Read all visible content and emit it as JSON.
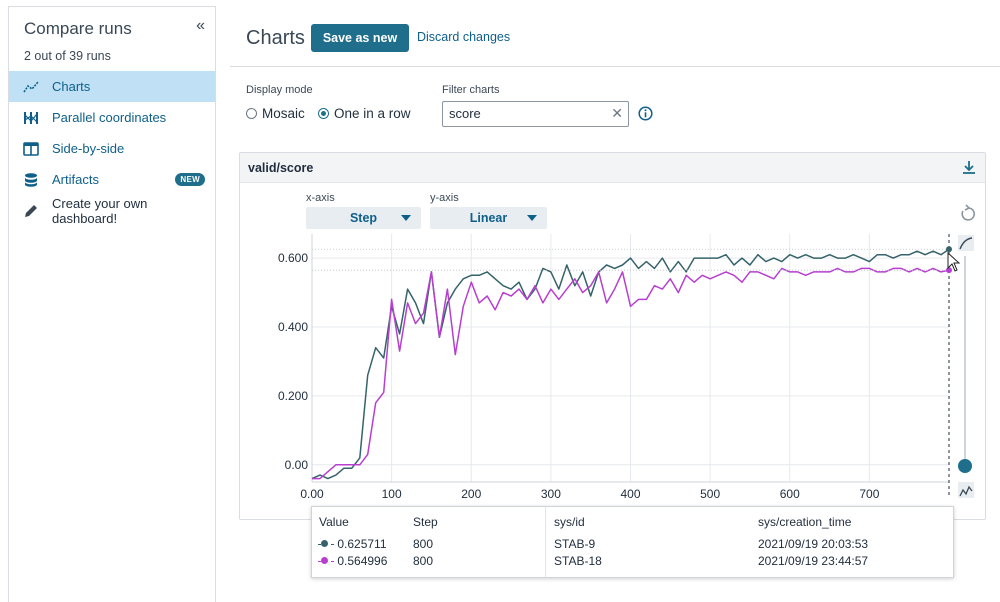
{
  "sidebar": {
    "title": "Compare runs",
    "collapse_glyph": "«",
    "subtitle": "2 out of 39 runs",
    "items": [
      {
        "label": "Charts",
        "icon": "line-chart-icon",
        "active": true
      },
      {
        "label": "Parallel coordinates",
        "icon": "parallel-coordinates-icon"
      },
      {
        "label": "Side-by-side",
        "icon": "side-by-side-icon"
      },
      {
        "label": "Artifacts",
        "icon": "database-icon",
        "badge": "NEW"
      },
      {
        "label": "Create your own dashboard!",
        "icon": "pencil-icon"
      }
    ]
  },
  "header": {
    "title": "Charts",
    "save_label": "Save as new",
    "discard_label": "Discard changes"
  },
  "controls": {
    "display_mode_label": "Display mode",
    "mode_options": [
      "Mosaic",
      "One in a row"
    ],
    "selected_mode": "One in a row",
    "filter_label": "Filter charts",
    "filter_value": "score",
    "clear_glyph": "✕"
  },
  "panel": {
    "title": "valid/score",
    "x_axis_label": "x-axis",
    "x_axis_value": "Step",
    "y_axis_label": "y-axis",
    "y_axis_value": "Linear"
  },
  "colors": {
    "accent": "#1f6e8c",
    "series_1": "#35636b",
    "series_2": "#b73fd0"
  },
  "chart_data": {
    "type": "line",
    "xlabel": "",
    "ylabel": "",
    "xlim": [
      0,
      800
    ],
    "ylim": [
      -0.05,
      0.67
    ],
    "x_ticks": [
      "0.00",
      "100",
      "200",
      "300",
      "400",
      "500",
      "600",
      "700"
    ],
    "y_ticks": [
      "0.00",
      "0.200",
      "0.400",
      "0.600"
    ],
    "cursor_x": 800,
    "series": [
      {
        "name": "STAB-9",
        "color": "#35636b",
        "x": [
          0,
          10,
          20,
          30,
          40,
          50,
          60,
          70,
          80,
          90,
          100,
          110,
          120,
          130,
          140,
          150,
          160,
          170,
          180,
          190,
          200,
          210,
          220,
          230,
          240,
          250,
          260,
          270,
          280,
          290,
          300,
          310,
          320,
          330,
          340,
          350,
          360,
          370,
          380,
          390,
          400,
          410,
          420,
          430,
          440,
          450,
          460,
          470,
          480,
          490,
          500,
          510,
          520,
          530,
          540,
          550,
          560,
          570,
          580,
          590,
          600,
          610,
          620,
          630,
          640,
          650,
          660,
          670,
          680,
          690,
          700,
          710,
          720,
          730,
          740,
          750,
          760,
          770,
          780,
          790,
          800
        ],
        "values": [
          -0.04,
          -0.03,
          -0.04,
          -0.03,
          -0.01,
          -0.01,
          0.02,
          0.26,
          0.34,
          0.31,
          0.46,
          0.38,
          0.51,
          0.47,
          0.41,
          0.56,
          0.37,
          0.47,
          0.51,
          0.54,
          0.55,
          0.55,
          0.56,
          0.54,
          0.52,
          0.51,
          0.53,
          0.48,
          0.51,
          0.57,
          0.56,
          0.51,
          0.58,
          0.52,
          0.56,
          0.49,
          0.56,
          0.58,
          0.57,
          0.58,
          0.6,
          0.57,
          0.59,
          0.57,
          0.6,
          0.56,
          0.59,
          0.56,
          0.6,
          0.6,
          0.6,
          0.6,
          0.61,
          0.58,
          0.6,
          0.58,
          0.61,
          0.59,
          0.6,
          0.59,
          0.61,
          0.6,
          0.61,
          0.6,
          0.6,
          0.61,
          0.6,
          0.6,
          0.61,
          0.6,
          0.59,
          0.61,
          0.61,
          0.6,
          0.61,
          0.61,
          0.62,
          0.61,
          0.62,
          0.61,
          0.625711
        ]
      },
      {
        "name": "STAB-18",
        "color": "#b73fd0",
        "x": [
          0,
          10,
          20,
          30,
          40,
          50,
          60,
          70,
          80,
          90,
          100,
          110,
          120,
          130,
          140,
          150,
          160,
          170,
          180,
          190,
          200,
          210,
          220,
          230,
          240,
          250,
          260,
          270,
          280,
          290,
          300,
          310,
          320,
          330,
          340,
          350,
          360,
          370,
          380,
          390,
          400,
          410,
          420,
          430,
          440,
          450,
          460,
          470,
          480,
          490,
          500,
          510,
          520,
          530,
          540,
          550,
          560,
          570,
          580,
          590,
          600,
          610,
          620,
          630,
          640,
          650,
          660,
          670,
          680,
          690,
          700,
          710,
          720,
          730,
          740,
          750,
          760,
          770,
          780,
          790,
          800
        ],
        "values": [
          -0.04,
          -0.04,
          -0.02,
          0.0,
          0.0,
          0.0,
          0.0,
          0.03,
          0.18,
          0.21,
          0.48,
          0.33,
          0.47,
          0.41,
          0.44,
          0.56,
          0.37,
          0.51,
          0.32,
          0.46,
          0.53,
          0.47,
          0.49,
          0.45,
          0.5,
          0.49,
          0.51,
          0.48,
          0.52,
          0.47,
          0.51,
          0.48,
          0.51,
          0.54,
          0.5,
          0.52,
          0.56,
          0.47,
          0.51,
          0.56,
          0.46,
          0.48,
          0.48,
          0.52,
          0.51,
          0.54,
          0.5,
          0.55,
          0.53,
          0.55,
          0.54,
          0.55,
          0.56,
          0.55,
          0.53,
          0.56,
          0.56,
          0.55,
          0.54,
          0.57,
          0.56,
          0.56,
          0.55,
          0.56,
          0.56,
          0.56,
          0.57,
          0.56,
          0.56,
          0.57,
          0.57,
          0.56,
          0.56,
          0.57,
          0.57,
          0.56,
          0.57,
          0.56,
          0.57,
          0.56,
          0.564996
        ]
      }
    ]
  },
  "tooltip": {
    "headers": {
      "value": "Value",
      "step": "Step",
      "id": "sys/id",
      "time": "sys/creation_time"
    },
    "rows": [
      {
        "value": "0.625711",
        "step": "800",
        "id": "STAB-9",
        "time": "2021/09/19 20:03:53",
        "color": "#35636b"
      },
      {
        "value": "0.564996",
        "step": "800",
        "id": "STAB-18",
        "time": "2021/09/19 23:44:57",
        "color": "#b73fd0"
      }
    ]
  }
}
